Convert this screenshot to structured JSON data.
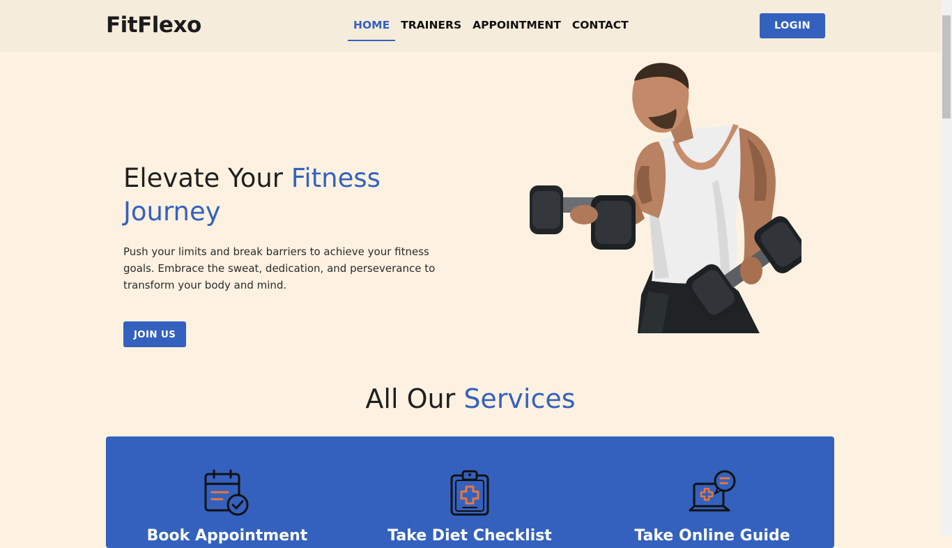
{
  "nav": {
    "brand": "FitFlexo",
    "links": [
      {
        "label": "HOME",
        "active": true
      },
      {
        "label": "TRAINERS",
        "active": false
      },
      {
        "label": "APPOINTMENT",
        "active": false
      },
      {
        "label": "CONTACT",
        "active": false
      }
    ],
    "login_label": "LOGIN"
  },
  "hero": {
    "title_plain": "Elevate Your ",
    "title_accent": "Fitness Journey",
    "description": "Push your limits and break barriers to achieve your fitness goals. Embrace the sweat, dedication, and perseverance to transform your body and mind.",
    "join_label": "JOIN US",
    "image_icon": "athlete-dumbbell-photo"
  },
  "services": {
    "title_plain": "All Our ",
    "title_accent": "Services",
    "items": [
      {
        "label": "Book Appointment",
        "icon": "calendar-check-icon"
      },
      {
        "label": "Take Diet Checklist",
        "icon": "medical-clipboard-icon"
      },
      {
        "label": "Take Online Guide",
        "icon": "laptop-chat-icon"
      }
    ]
  },
  "colors": {
    "accent": "#3461be",
    "page_bg": "#fdf2e1",
    "nav_bg": "#f6ecdc",
    "icon_orange": "#e8783a"
  }
}
